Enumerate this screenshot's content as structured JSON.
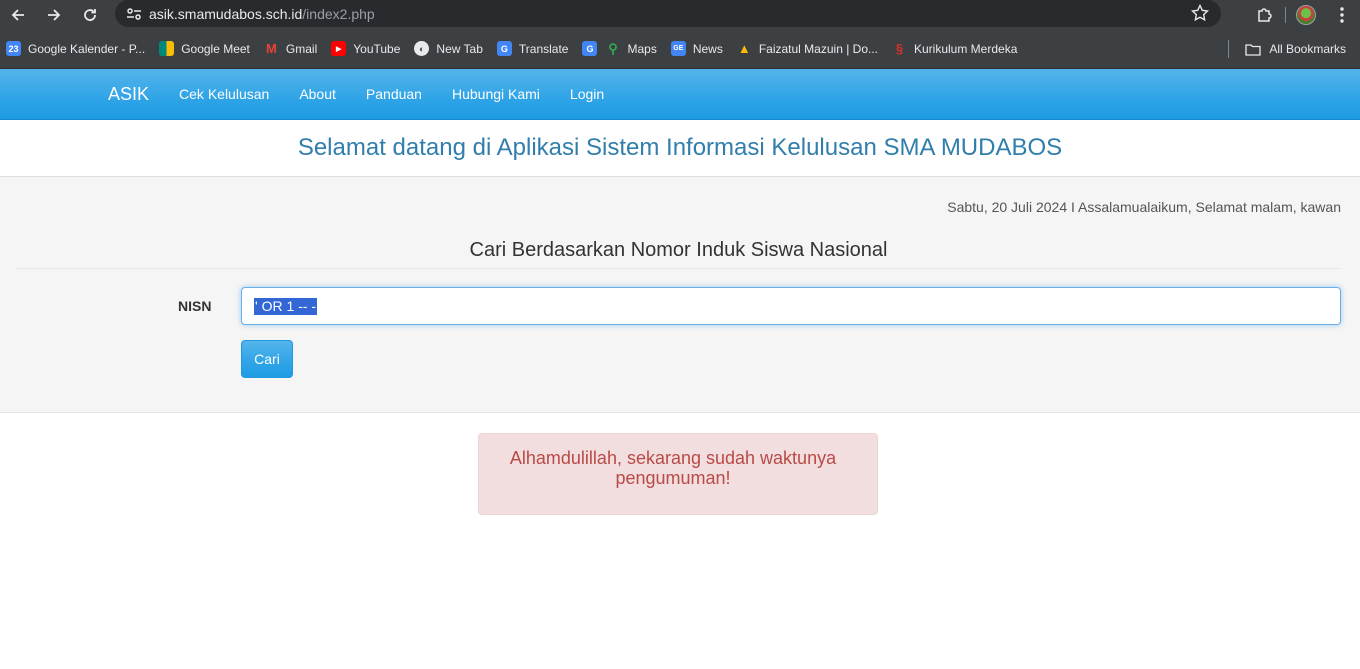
{
  "browser": {
    "url_host": "asik.smamudabos.sch.id",
    "url_path": "/index2.php",
    "bookmarks": [
      {
        "label": "Google Kalender - P...",
        "icon": "calendar-icon",
        "color": "#4285f4"
      },
      {
        "label": "Google Meet",
        "icon": "meet-icon",
        "color": "#00897b"
      },
      {
        "label": "Gmail",
        "icon": "gmail-icon",
        "color": "#ea4335"
      },
      {
        "label": "YouTube",
        "icon": "youtube-icon",
        "color": "#ff0000"
      },
      {
        "label": "New Tab",
        "icon": "globe-icon",
        "color": "#e8eaed"
      },
      {
        "label": "Translate",
        "icon": "translate-icon",
        "color": "#4285f4"
      },
      {
        "label": "",
        "icon": "translate-icon",
        "color": "#4285f4"
      },
      {
        "label": "Maps",
        "icon": "maps-icon",
        "color": "#34a853"
      },
      {
        "label": "News",
        "icon": "news-icon",
        "color": "#4285f4"
      },
      {
        "label": "Faizatul Mazuin | Do...",
        "icon": "drive-icon",
        "color": "#fbbc04"
      },
      {
        "label": "Kurikulum Merdeka",
        "icon": "kurikulum-icon",
        "color": "#d93025"
      }
    ],
    "all_bookmarks": "All Bookmarks"
  },
  "navbar": {
    "brand": "ASIK",
    "links": [
      "Cek Kelulusan",
      "About",
      "Panduan",
      "Hubungi Kami",
      "Login"
    ]
  },
  "welcome": "Selamat datang di Aplikasi Sistem Informasi Kelulusan SMA MUDABOS",
  "dateline": "Sabtu, 20 Juli 2024 I Assalamualaikum, Selamat malam, kawan",
  "search": {
    "title": "Cari Berdasarkan Nomor Induk Siswa Nasional",
    "label": "NISN",
    "value": "' OR 1 -- -",
    "button": "Cari"
  },
  "alert": "Alhamdulillah, sekarang sudah waktunya pengumuman!",
  "colors": {
    "brand_blue": "#2fa4e7",
    "title_blue": "#317eac",
    "alert_text": "#b94a48",
    "alert_bg": "#f2dede"
  }
}
